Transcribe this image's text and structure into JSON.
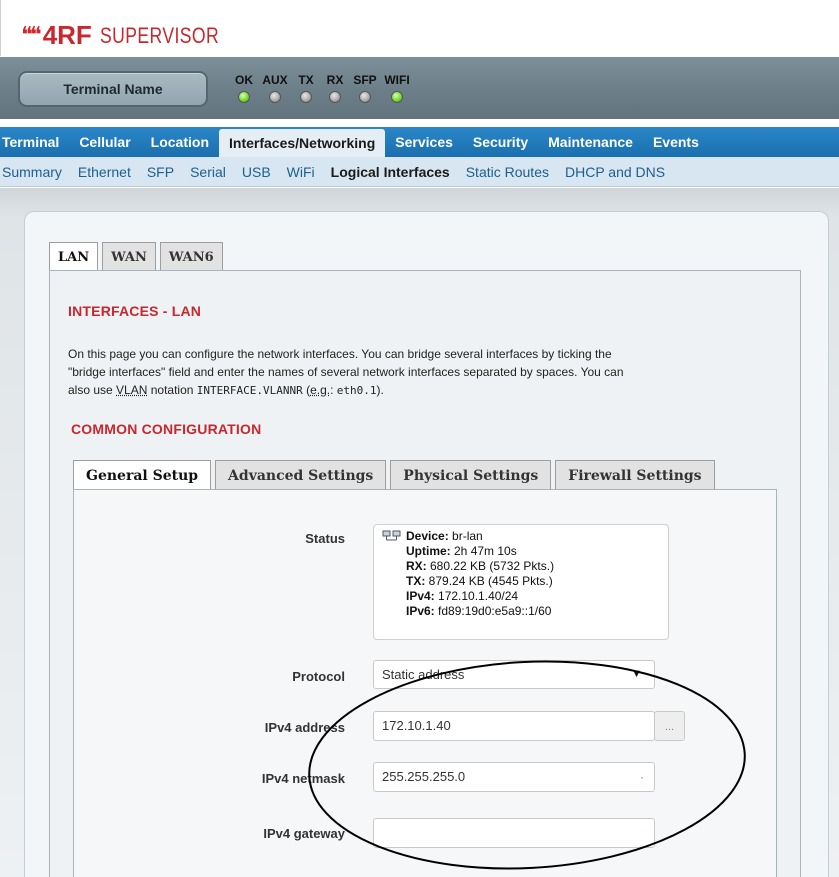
{
  "header": {
    "logo_mark": "❝❝",
    "brand": "4RF",
    "product": "SUPERVISOR"
  },
  "statusbar": {
    "terminal_button": "Terminal Name",
    "indicators": [
      {
        "label": "OK",
        "state": "green"
      },
      {
        "label": "AUX",
        "state": "grey"
      },
      {
        "label": "TX",
        "state": "grey"
      },
      {
        "label": "RX",
        "state": "grey"
      },
      {
        "label": "SFP",
        "state": "grey"
      },
      {
        "label": "WIFI",
        "state": "green"
      }
    ]
  },
  "main_nav": {
    "items": [
      "Terminal",
      "Cellular",
      "Location",
      "Interfaces/Networking",
      "Services",
      "Security",
      "Maintenance",
      "Events"
    ],
    "active": "Interfaces/Networking"
  },
  "sub_nav": {
    "items": [
      "Summary",
      "Ethernet",
      "SFP",
      "Serial",
      "USB",
      "WiFi",
      "Logical Interfaces",
      "Static Routes",
      "DHCP and DNS"
    ],
    "active": "Logical Interfaces"
  },
  "interface_tabs": {
    "items": [
      "LAN",
      "WAN",
      "WAN6"
    ],
    "active": "LAN"
  },
  "page": {
    "title": "INTERFACES - LAN",
    "desc_1": "On this page you can configure the network interfaces. You can bridge several interfaces by ticking the",
    "desc_2": "\"bridge interfaces\" field and enter the names of several network interfaces separated by spaces. You can",
    "desc_3a": "also use ",
    "desc_vlan": "VLAN",
    "desc_3b": " notation ",
    "desc_code": "INTERFACE.VLANNR",
    "desc_3c": " (",
    "desc_eg": "e.g.",
    "desc_3d": ": ",
    "desc_code2": "eth0.1",
    "desc_3e": ").",
    "section_title": "COMMON CONFIGURATION"
  },
  "config_tabs": {
    "items": [
      "General Setup",
      "Advanced Settings",
      "Physical Settings",
      "Firewall Settings"
    ],
    "active": "General Setup"
  },
  "form": {
    "status_label": "Status",
    "status": {
      "device_key": "Device:",
      "device_val": " br-lan",
      "uptime_key": "Uptime:",
      "uptime_val": " 2h 47m 10s",
      "rx_key": "RX:",
      "rx_val": " 680.22 KB (5732 Pkts.)",
      "tx_key": "TX:",
      "tx_val": " 879.24 KB (4545 Pkts.)",
      "ipv4_key": "IPv4:",
      "ipv4_val": " 172.10.1.40/24",
      "ipv6_key": "IPv6:",
      "ipv6_val": " fd89:19d0:e5a9::1/60"
    },
    "protocol_label": "Protocol",
    "protocol_value": "Static address",
    "ipv4_address_label": "IPv4 address",
    "ipv4_address_value": "172.10.1.40",
    "ipv4_netmask_label": "IPv4 netmask",
    "ipv4_netmask_value": "255.255.255.0",
    "ipv4_gateway_label": "IPv4 gateway",
    "ipv4_gateway_value": "",
    "ellipsis": "..."
  },
  "colors": {
    "brand_red": "#c8272d",
    "nav_blue": "#1f78b9",
    "subnav_bg": "#d7e6f0"
  }
}
